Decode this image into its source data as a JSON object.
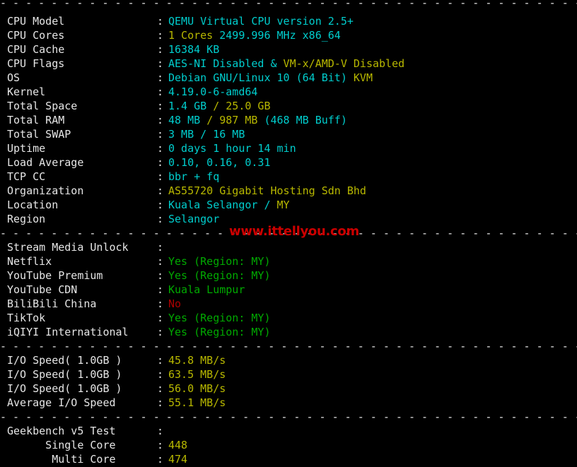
{
  "terminal": {
    "background_color": "#000000",
    "separator_char": "-",
    "separator_line": "- - - - - - - - - - - - - - - - - - - - - - - - - - - - - - - - - - - - - - - - - - - - - - - - - - - - -",
    "colon": ":",
    "colors": {
      "label": "#e6e6e6",
      "cyan": "#00cdcd",
      "yellow": "#b8b800",
      "green": "#00aa00",
      "red": "#aa0000",
      "watermark": "#cc0000"
    }
  },
  "watermark": {
    "text": "www.ittellyou.com"
  },
  "system_info": [
    {
      "label": "CPU Model",
      "segments": [
        {
          "text": "QEMU Virtual CPU version 2.5+",
          "color": "cyan"
        }
      ]
    },
    {
      "label": "CPU Cores",
      "segments": [
        {
          "text": "1 Cores",
          "color": "yellow"
        },
        {
          "text": " 2499.996 MHz x86_64",
          "color": "cyan"
        }
      ]
    },
    {
      "label": "CPU Cache",
      "segments": [
        {
          "text": "16384 KB",
          "color": "cyan"
        }
      ]
    },
    {
      "label": "CPU Flags",
      "segments": [
        {
          "text": "AES-NI Disabled &",
          "color": "cyan"
        },
        {
          "text": " VM-x/AMD-V Disabled",
          "color": "yellow"
        }
      ]
    },
    {
      "label": "OS",
      "segments": [
        {
          "text": "Debian GNU/Linux 10 (64 Bit)",
          "color": "cyan"
        },
        {
          "text": " KVM",
          "color": "yellow"
        }
      ]
    },
    {
      "label": "Kernel",
      "segments": [
        {
          "text": "4.19.0-6-amd64",
          "color": "cyan"
        }
      ]
    },
    {
      "label": "Total Space",
      "segments": [
        {
          "text": "1.4 GB ",
          "color": "cyan"
        },
        {
          "text": "/ 25.0 GB",
          "color": "yellow"
        }
      ]
    },
    {
      "label": "Total RAM",
      "segments": [
        {
          "text": "48 MB ",
          "color": "cyan"
        },
        {
          "text": "/ 987 MB ",
          "color": "yellow"
        },
        {
          "text": "(468 MB Buff)",
          "color": "cyan"
        }
      ]
    },
    {
      "label": "Total SWAP",
      "segments": [
        {
          "text": "3 MB / 16 MB",
          "color": "cyan"
        }
      ]
    },
    {
      "label": "Uptime",
      "segments": [
        {
          "text": "0 days 1 hour 14 min",
          "color": "cyan"
        }
      ]
    },
    {
      "label": "Load Average",
      "segments": [
        {
          "text": "0.10, 0.16, 0.31",
          "color": "cyan"
        }
      ]
    },
    {
      "label": "TCP CC",
      "segments": [
        {
          "text": "bbr + fq",
          "color": "cyan"
        }
      ]
    },
    {
      "label": "Organization",
      "segments": [
        {
          "text": "AS55720 Gigabit Hosting Sdn Bhd",
          "color": "yellow"
        }
      ]
    },
    {
      "label": "Location",
      "segments": [
        {
          "text": "Kuala Selangor / ",
          "color": "cyan"
        },
        {
          "text": "MY",
          "color": "yellow"
        }
      ]
    },
    {
      "label": "Region",
      "segments": [
        {
          "text": "Selangor",
          "color": "cyan"
        }
      ]
    }
  ],
  "stream_media_unlock": {
    "header_label": "Stream Media Unlock",
    "header_value": "",
    "items": [
      {
        "label": "Netflix",
        "segments": [
          {
            "text": "Yes (Region: MY)",
            "color": "green"
          }
        ]
      },
      {
        "label": "YouTube Premium",
        "segments": [
          {
            "text": "Yes (Region: MY)",
            "color": "green"
          }
        ]
      },
      {
        "label": "YouTube CDN",
        "segments": [
          {
            "text": "Kuala Lumpur",
            "color": "green"
          }
        ]
      },
      {
        "label": "BiliBili China",
        "segments": [
          {
            "text": "No",
            "color": "red"
          }
        ]
      },
      {
        "label": "TikTok",
        "segments": [
          {
            "text": "Yes (Region: MY)",
            "color": "green"
          }
        ]
      },
      {
        "label": "iQIYI International",
        "segments": [
          {
            "text": "Yes (Region: MY)",
            "color": "green"
          }
        ]
      }
    ]
  },
  "io_speed": [
    {
      "label": "I/O Speed( 1.0GB )",
      "segments": [
        {
          "text": "45.8 MB/s",
          "color": "yellow"
        }
      ]
    },
    {
      "label": "I/O Speed( 1.0GB )",
      "segments": [
        {
          "text": "63.5 MB/s",
          "color": "yellow"
        }
      ]
    },
    {
      "label": "I/O Speed( 1.0GB )",
      "segments": [
        {
          "text": "56.0 MB/s",
          "color": "yellow"
        }
      ]
    },
    {
      "label": "Average I/O Speed",
      "segments": [
        {
          "text": "55.1 MB/s",
          "color": "yellow"
        }
      ]
    }
  ],
  "geekbench": {
    "header_label": "Geekbench v5 Test",
    "header_value": "",
    "items": [
      {
        "label": "      Single Core",
        "segments": [
          {
            "text": "448",
            "color": "yellow"
          }
        ]
      },
      {
        "label": "       Multi Core",
        "segments": [
          {
            "text": "474",
            "color": "yellow"
          }
        ]
      }
    ]
  }
}
